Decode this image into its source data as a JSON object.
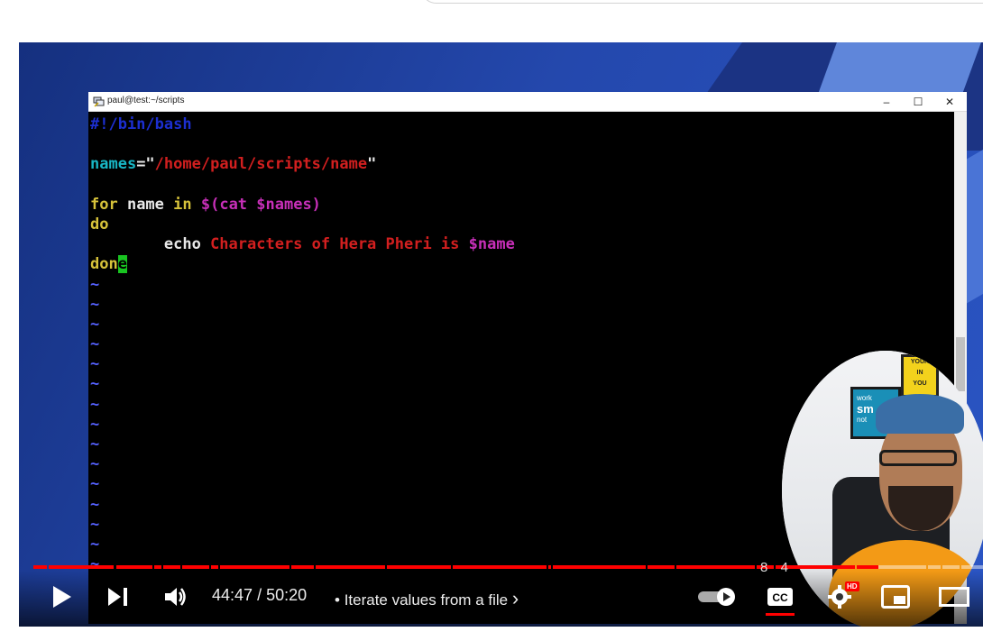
{
  "player": {
    "current_time": "44:47",
    "separator": "/",
    "duration": "50:20",
    "bullet": "•",
    "chapter_title": "Iterate values from a file",
    "chapter_chevron": "›",
    "overlay_digits": "8  4",
    "hd_badge": "HD",
    "progress_fraction": 0.89,
    "accent_color": "#ff0000"
  },
  "terminal": {
    "title": "paul@test:~/scripts",
    "minimize": "–",
    "maximize": "☐",
    "close": "✕",
    "lines": [
      [
        {
          "t": "#!/bin/bash",
          "c": "c-comment"
        }
      ],
      [],
      [
        {
          "t": "names",
          "c": "c-var"
        },
        {
          "t": "=\"",
          "c": "c-plain"
        },
        {
          "t": "/home/paul/scripts/name",
          "c": "c-str"
        },
        {
          "t": "\"",
          "c": "c-plain"
        }
      ],
      [],
      [
        {
          "t": "for",
          "c": "c-kw"
        },
        {
          "t": " name ",
          "c": "c-plain"
        },
        {
          "t": "in",
          "c": "c-kw"
        },
        {
          "t": " $(cat $names)",
          "c": "c-sub"
        }
      ],
      [
        {
          "t": "do",
          "c": "c-kw"
        }
      ],
      [
        {
          "t": "        echo ",
          "c": "c-plain"
        },
        {
          "t": "Characters of Hera Pheri is ",
          "c": "c-str"
        },
        {
          "t": "$name",
          "c": "c-sub"
        }
      ],
      [
        {
          "t": "don",
          "c": "c-kw"
        },
        {
          "t": "e",
          "c": "cursor"
        }
      ],
      [
        {
          "t": "~",
          "c": "c-tilde"
        }
      ],
      [
        {
          "t": "~",
          "c": "c-tilde"
        }
      ],
      [
        {
          "t": "~",
          "c": "c-tilde"
        }
      ],
      [
        {
          "t": "~",
          "c": "c-tilde"
        }
      ],
      [
        {
          "t": "~",
          "c": "c-tilde"
        }
      ],
      [
        {
          "t": "~",
          "c": "c-tilde"
        }
      ],
      [
        {
          "t": "~",
          "c": "c-tilde"
        }
      ],
      [
        {
          "t": "~",
          "c": "c-tilde"
        }
      ],
      [
        {
          "t": "~",
          "c": "c-tilde"
        }
      ],
      [
        {
          "t": "~",
          "c": "c-tilde"
        }
      ],
      [
        {
          "t": "~",
          "c": "c-tilde"
        }
      ],
      [
        {
          "t": "~",
          "c": "c-tilde"
        }
      ],
      [
        {
          "t": "~",
          "c": "c-tilde"
        }
      ],
      [
        {
          "t": "~",
          "c": "c-tilde"
        }
      ],
      [
        {
          "t": "~",
          "c": "c-tilde"
        }
      ]
    ]
  },
  "icons": {
    "play": "play-icon",
    "next": "next-icon",
    "volume": "volume-icon",
    "autoplay": "autoplay-toggle",
    "captions": "captions-icon",
    "settings": "gear-icon",
    "miniplayer": "miniplayer-icon",
    "theater": "theater-icon"
  },
  "webcam": {
    "poster_text_top": "YOUR",
    "poster_text_mid": "IN",
    "poster_text_bottom": "YOU",
    "poster2_text_top": "work",
    "poster2_text_mid": "sm",
    "poster2_text_bottom": "not"
  }
}
